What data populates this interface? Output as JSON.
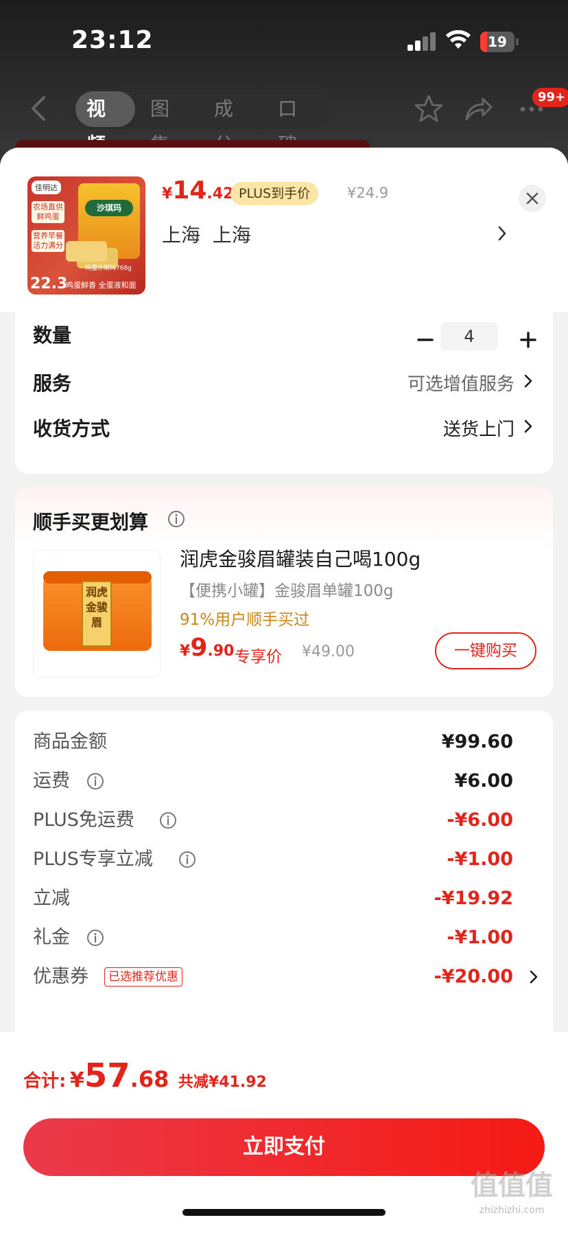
{
  "status_bar": {
    "time": "23:12",
    "battery": "19",
    "battery_level": 0.19
  },
  "nav": {
    "tabs": [
      {
        "label": "视频",
        "active": true
      },
      {
        "label": "图集",
        "active": false
      },
      {
        "label": "成分",
        "active": false
      },
      {
        "label": "口碑",
        "active": false
      }
    ],
    "message_badge": "99+",
    "icons": [
      "back-icon",
      "star-icon",
      "share-icon",
      "more-icon"
    ]
  },
  "product": {
    "price_currency": "¥",
    "price_int": "14",
    "price_dec": ".42",
    "plus_label": "PLUS到手价",
    "original_price": "¥24.9",
    "address": "上海  上海",
    "thumb": {
      "brand": "佳明达",
      "tag1": "农场直供 鲜鸡蛋",
      "tag2": "营养早餐 活力满分",
      "bag_label": "沙琪玛",
      "weight": "鸡蛋沙琪玛768g",
      "price": "22.3",
      "slogan": "鸡蛋鲜香 全蛋液和面"
    }
  },
  "options": {
    "quantity_label": "数量",
    "quantity_value": "4",
    "minus": "−",
    "plus": "+",
    "service_label": "服务",
    "service_value": "可选增值服务",
    "delivery_label": "收货方式",
    "delivery_value": "送货上门"
  },
  "upsell": {
    "title": "顺手买更划算",
    "name": "润虎金骏眉罐装自己喝100g",
    "subtitle": "【便携小罐】金骏眉单罐100g",
    "buy_rate": "91%用户顺手买过",
    "price_currency": "¥",
    "price_int": "9",
    "price_dec": ".90",
    "price_label": "专享价",
    "original_price": "¥49.00",
    "buy_button": "一键购买",
    "tin_label": "润虎金骏眉"
  },
  "summary": [
    {
      "label": "商品金额",
      "value": "¥99.60",
      "red": false,
      "info": false
    },
    {
      "label": "运费",
      "value": "¥6.00",
      "red": false,
      "info": true
    },
    {
      "label": "PLUS免运费",
      "value": "-¥6.00",
      "red": true,
      "info": true
    },
    {
      "label": "PLUS专享立减",
      "value": "-¥1.00",
      "red": true,
      "info": true
    },
    {
      "label": "立减",
      "value": "-¥19.92",
      "red": true,
      "info": false
    },
    {
      "label": "礼金",
      "value": "-¥1.00",
      "red": true,
      "info": true
    },
    {
      "label": "优惠券",
      "value": "-¥20.00",
      "red": true,
      "info": false,
      "tag": "已选推荐优惠"
    }
  ],
  "total": {
    "label": "合计:",
    "currency": "¥",
    "int": "57",
    "dec": ".68",
    "saved": "共减¥41.92",
    "pay_button": "立即支付"
  },
  "watermark": {
    "main": "值值值",
    "sub": "zhizhizhi.com"
  },
  "colors": {
    "accent": "#e1251b",
    "plus_pill": "#fbe6a8",
    "rate": "#c9861a"
  }
}
